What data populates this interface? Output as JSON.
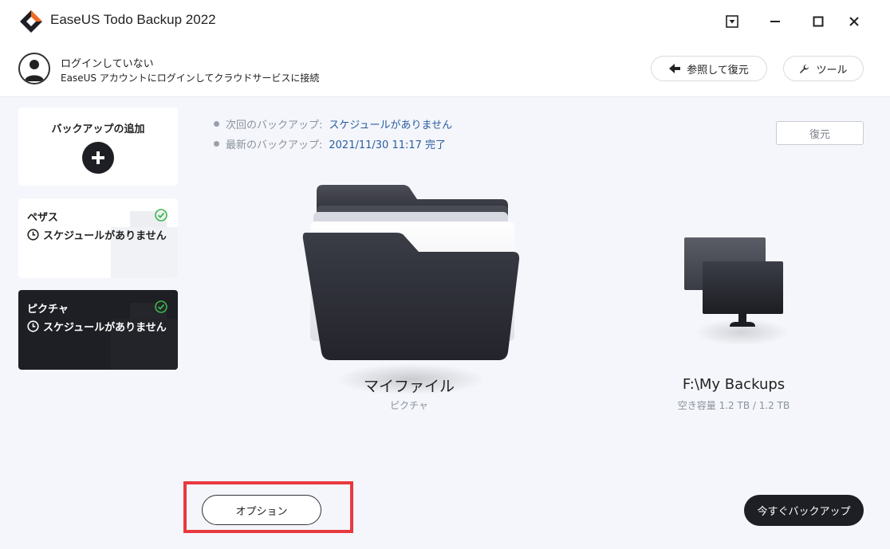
{
  "app": {
    "title": "EaseUS Todo Backup 2022"
  },
  "window_controls": [
    "dropdown-icon",
    "minimize-icon",
    "maximize-icon",
    "close-icon"
  ],
  "account": {
    "status": "ログインしていない",
    "prompt": "EaseUS アカウントにログインしてクラウドサービスに接続"
  },
  "toolbar": {
    "browse_restore_label": "参照して復元",
    "tools_label": "ツール"
  },
  "sidebar": {
    "add_backup_label": "バックアップの追加",
    "tasks": [
      {
        "name": "ペザス",
        "schedule": "スケジュールがありません",
        "selected": false
      },
      {
        "name": "ピクチャ",
        "schedule": "スケジュールがありません",
        "selected": true
      }
    ]
  },
  "info": {
    "next_label": "次回のバックアップ:",
    "next_value": "スケジュールがありません",
    "last_label": "最新のバックアップ:",
    "last_value": "2021/11/30 11:17 完了"
  },
  "restore_label": "復元",
  "source": {
    "name": "マイファイル",
    "subtitle": "ピクチャ"
  },
  "destination": {
    "name": "F:\\My Backups",
    "subtitle": "空き容量 1.2 TB / 1.2 TB"
  },
  "buttons": {
    "options_label": "オプション",
    "backup_now_label": "今すぐバックアップ"
  },
  "colors": {
    "accent_orange": "#f26a21",
    "dark": "#1e1f24",
    "link_blue": "#2a5d9f",
    "highlight_red": "#e8393f",
    "check_green": "#3cb84a"
  }
}
